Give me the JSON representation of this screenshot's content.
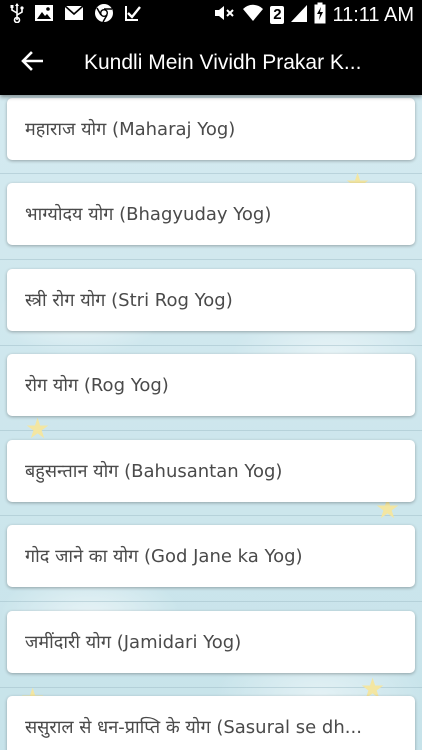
{
  "status_bar": {
    "time": "11:11 AM",
    "sim_badge": "2",
    "left_icons": [
      "usb-icon",
      "image-icon",
      "mail-icon",
      "chrome-icon",
      "task-icon"
    ],
    "right_icons": [
      "mute-icon",
      "wifi-icon",
      "signal-icon",
      "battery-icon"
    ]
  },
  "app_bar": {
    "title": "Kundli Mein Vividh Prakar K...",
    "back_icon": "arrow-back-icon"
  },
  "list": {
    "items": [
      {
        "label": "महाराज योग (Maharaj Yog)"
      },
      {
        "label": "भाग्योदय योग (Bhagyuday Yog)"
      },
      {
        "label": "स्त्री रोग योग (Stri Rog Yog)"
      },
      {
        "label": "रोग योग (Rog Yog)"
      },
      {
        "label": "बहुसन्तान योग (Bahusantan Yog)"
      },
      {
        "label": "गोद जाने का योग (God Jane ka Yog)"
      },
      {
        "label": "जमींदारी योग (Jamidari Yog)"
      },
      {
        "label": "ससुराल से धन-प्राप्ति के योग (Sasural se dh..."
      }
    ]
  },
  "colors": {
    "app_bar_bg": "#000000",
    "card_bg": "#ffffff",
    "card_text": "#4a4a4a",
    "background": "#cfe6ec"
  }
}
